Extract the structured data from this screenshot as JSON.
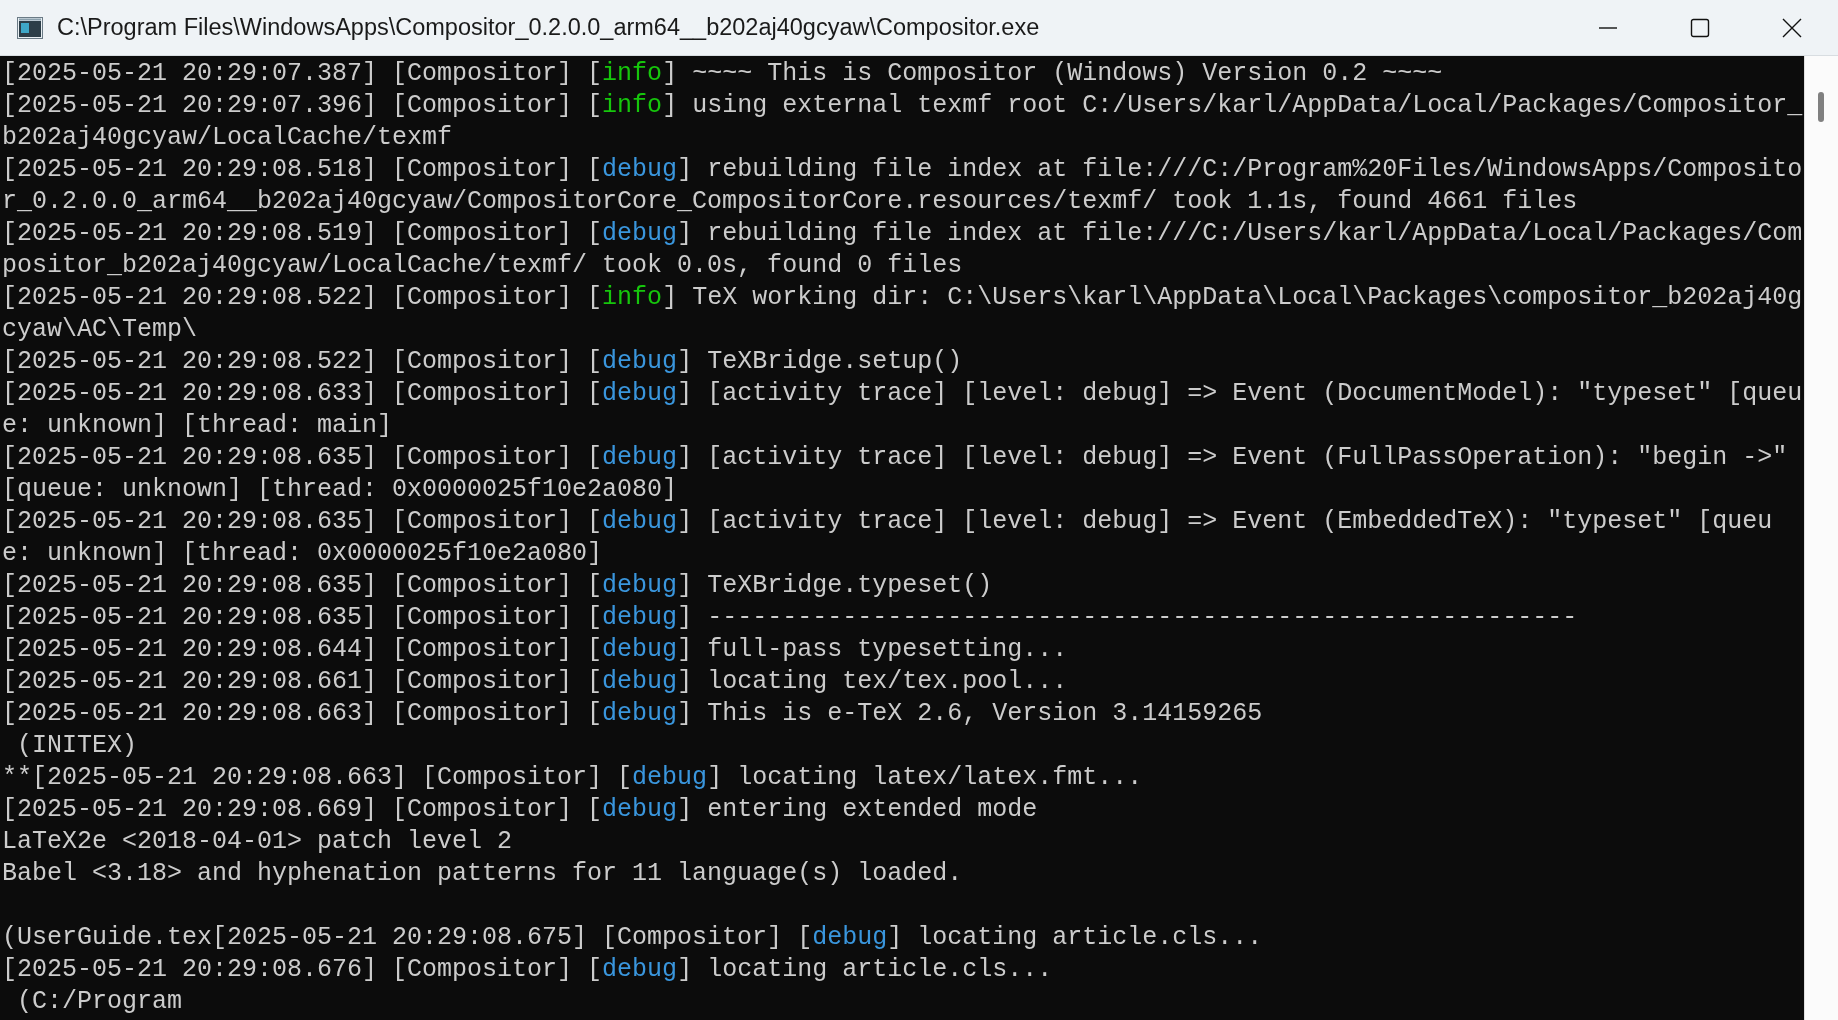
{
  "window": {
    "title": "C:\\Program Files\\WindowsApps\\Compositor_0.2.0.0_arm64__b202aj40gcyaw\\Compositor.exe"
  },
  "lines": [
    {
      "kind": "log",
      "lead": "[2025-05-21 20:29:07.387] [Compositor] [",
      "level": "info",
      "color": "#16c60c",
      "rest": "] ~~~~ This is Compositor (Windows) Version 0.2 ~~~~"
    },
    {
      "kind": "log",
      "lead": "[2025-05-21 20:29:07.396] [Compositor] [",
      "level": "info",
      "color": "#16c60c",
      "rest": "] using external texmf root C:/Users/karl/AppData/Local/Packages/Compositor_b202aj40gcyaw/LocalCache/texmf"
    },
    {
      "kind": "log",
      "lead": "[2025-05-21 20:29:08.518] [Compositor] [",
      "level": "debug",
      "color": "#3a96dd",
      "rest": "] rebuilding file index at file:///C:/Program%20Files/WindowsApps/Compositor_0.2.0.0_arm64__b202aj40gcyaw/CompositorCore_CompositorCore.resources/texmf/ took 1.1s, found 4661 files"
    },
    {
      "kind": "log",
      "lead": "[2025-05-21 20:29:08.519] [Compositor] [",
      "level": "debug",
      "color": "#3a96dd",
      "rest": "] rebuilding file index at file:///C:/Users/karl/AppData/Local/Packages/Compositor_b202aj40gcyaw/LocalCache/texmf/ took 0.0s, found 0 files"
    },
    {
      "kind": "log",
      "lead": "[2025-05-21 20:29:08.522] [Compositor] [",
      "level": "info",
      "color": "#16c60c",
      "rest": "] TeX working dir: C:\\Users\\karl\\AppData\\Local\\Packages\\compositor_b202aj40gcyaw\\AC\\Temp\\"
    },
    {
      "kind": "log",
      "lead": "[2025-05-21 20:29:08.522] [Compositor] [",
      "level": "debug",
      "color": "#3a96dd",
      "rest": "] TeXBridge.setup()"
    },
    {
      "kind": "log",
      "lead": "[2025-05-21 20:29:08.633] [Compositor] [",
      "level": "debug",
      "color": "#3a96dd",
      "rest": "] [activity trace] [level: debug] => Event (DocumentModel): \"typeset\" [queue: unknown] [thread: main]"
    },
    {
      "kind": "log",
      "lead": "[2025-05-21 20:29:08.635] [Compositor] [",
      "level": "debug",
      "color": "#3a96dd",
      "rest": "] [activity trace] [level: debug] => Event (FullPassOperation): \"begin ->\" [queue: unknown] [thread: 0x0000025f10e2a080]"
    },
    {
      "kind": "log",
      "lead": "[2025-05-21 20:29:08.635] [Compositor] [",
      "level": "debug",
      "color": "#3a96dd",
      "rest": "] [activity trace] [level: debug] => Event (EmbeddedTeX): \"typeset\" [queue: unknown] [thread: 0x0000025f10e2a080]"
    },
    {
      "kind": "log",
      "lead": "[2025-05-21 20:29:08.635] [Compositor] [",
      "level": "debug",
      "color": "#3a96dd",
      "rest": "] TeXBridge.typeset()"
    },
    {
      "kind": "log",
      "lead": "[2025-05-21 20:29:08.635] [Compositor] [",
      "level": "debug",
      "color": "#3a96dd",
      "rest": "] ----------------------------------------------------------"
    },
    {
      "kind": "log",
      "lead": "[2025-05-21 20:29:08.644] [Compositor] [",
      "level": "debug",
      "color": "#3a96dd",
      "rest": "] full-pass typesetting..."
    },
    {
      "kind": "log",
      "lead": "[2025-05-21 20:29:08.661] [Compositor] [",
      "level": "debug",
      "color": "#3a96dd",
      "rest": "] locating tex/tex.pool..."
    },
    {
      "kind": "log",
      "lead": "[2025-05-21 20:29:08.663] [Compositor] [",
      "level": "debug",
      "color": "#3a96dd",
      "rest": "] This is e-TeX 2.6, Version 3.14159265"
    },
    {
      "kind": "plain",
      "text": " (INITEX)"
    },
    {
      "kind": "log",
      "lead": "**[2025-05-21 20:29:08.663] [Compositor] [",
      "level": "debug",
      "color": "#3a96dd",
      "rest": "] locating latex/latex.fmt..."
    },
    {
      "kind": "log",
      "lead": "[2025-05-21 20:29:08.669] [Compositor] [",
      "level": "debug",
      "color": "#3a96dd",
      "rest": "] entering extended mode"
    },
    {
      "kind": "plain",
      "text": "LaTeX2e <2018-04-01> patch level 2"
    },
    {
      "kind": "plain",
      "text": "Babel <3.18> and hyphenation patterns for 11 language(s) loaded."
    },
    {
      "kind": "blank"
    },
    {
      "kind": "log",
      "lead": "(UserGuide.tex[2025-05-21 20:29:08.675] [Compositor] [",
      "level": "debug",
      "color": "#3a96dd",
      "rest": "] locating article.cls..."
    },
    {
      "kind": "log",
      "lead": "[2025-05-21 20:29:08.676] [Compositor] [",
      "level": "debug",
      "color": "#3a96dd",
      "rest": "] locating article.cls..."
    },
    {
      "kind": "plain",
      "text": " (C:/Program"
    }
  ]
}
